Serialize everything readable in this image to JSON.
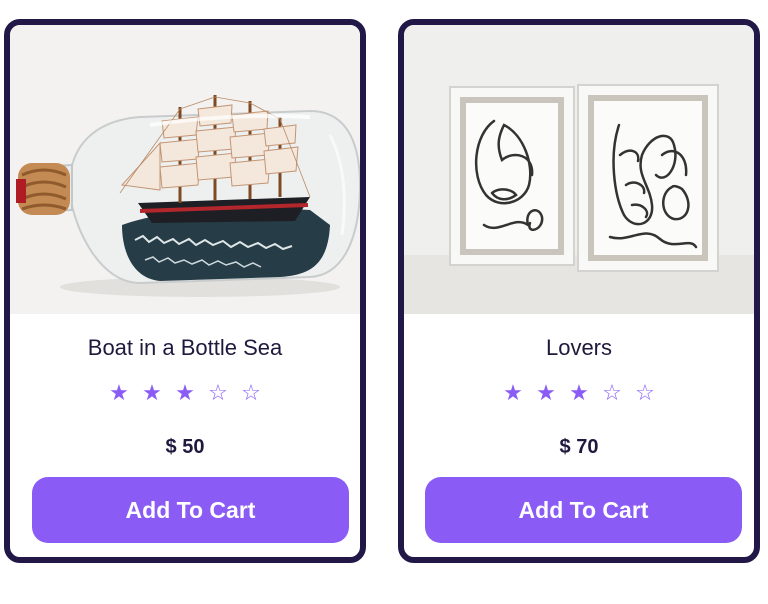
{
  "colors": {
    "accent": "#8a5cf5",
    "card_border": "#211847",
    "text": "#1f1a3d"
  },
  "products": [
    {
      "title": "Boat in a Bottle Sea",
      "image_subject": "ship in a glass bottle",
      "rating": 3,
      "rating_max": 5,
      "stars": [
        "★",
        "★",
        "★",
        "☆",
        "☆"
      ],
      "price": "$ 50",
      "button_label": "Add To Cart"
    },
    {
      "title": "Lovers",
      "image_subject": "two framed line-art face drawings",
      "rating": 3,
      "rating_max": 5,
      "stars": [
        "★",
        "★",
        "★",
        "☆",
        "☆"
      ],
      "price": "$ 70",
      "button_label": "Add To Cart"
    }
  ]
}
